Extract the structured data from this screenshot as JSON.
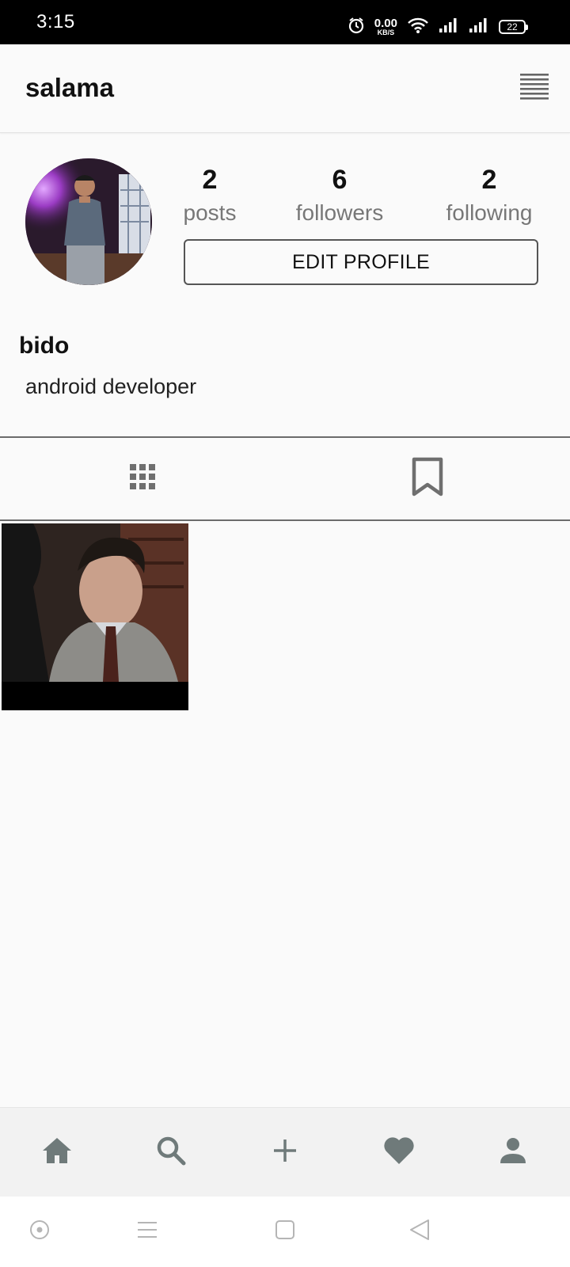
{
  "status_bar": {
    "time": "3:15",
    "net_speed": "0.00",
    "net_unit": "KB/S",
    "battery": "22"
  },
  "app_bar": {
    "title": "salama",
    "menu_icon": "menu-lines-icon"
  },
  "profile": {
    "stats": [
      {
        "value": "2",
        "label": "posts"
      },
      {
        "value": "6",
        "label": "followers"
      },
      {
        "value": "2",
        "label": "following"
      }
    ],
    "edit_button": "EDIT PROFILE",
    "display_name": "bido",
    "bio": "android developer"
  },
  "tabs": [
    {
      "icon": "grid-icon",
      "selected": true
    },
    {
      "icon": "bookmark-icon",
      "selected": false
    }
  ],
  "bottom_nav": [
    {
      "icon": "home-icon"
    },
    {
      "icon": "search-icon"
    },
    {
      "icon": "add-icon"
    },
    {
      "icon": "heart-icon"
    },
    {
      "icon": "profile-icon"
    }
  ],
  "colors": {
    "background": "#fafafa",
    "icon_gray": "#6f7a7a",
    "text_primary": "#111111",
    "text_secondary": "#777777"
  }
}
